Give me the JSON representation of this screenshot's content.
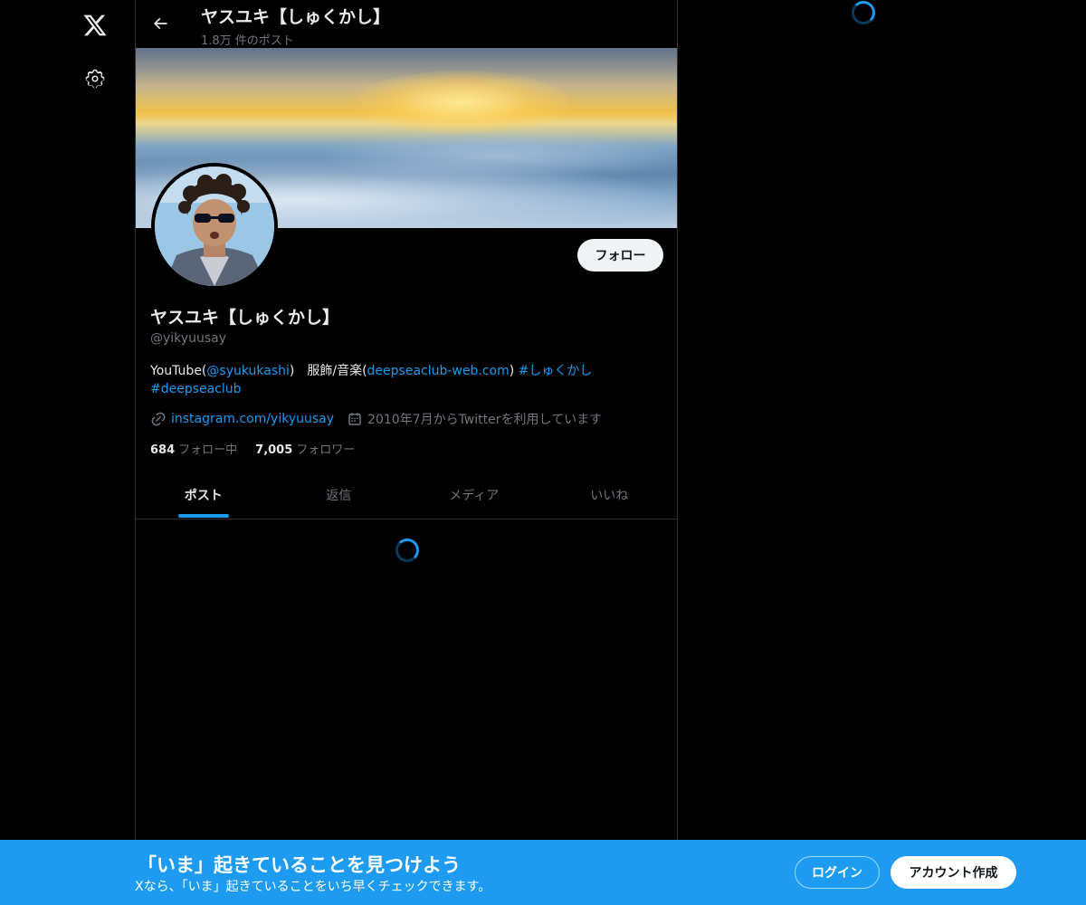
{
  "nav": {
    "logo_icon": "x-logo-icon",
    "settings_icon": "gear-icon"
  },
  "header": {
    "name": "ヤスユキ【しゅくかし】",
    "post_count": "1.8万 件のポスト"
  },
  "profile": {
    "name": "ヤスユキ【しゅくかし】",
    "handle": "@yikyuusay",
    "follow_label": "フォロー",
    "bio": {
      "part1": "YouTube(",
      "mention": "@syukukashi",
      "part2": ")　服飾/音楽(",
      "link": "deepseaclub-web.com",
      "part3": ") ",
      "hashtag1": "#しゅくかし",
      "hashtag2": "#deepseaclub"
    },
    "website": "instagram.com/yikyuusay",
    "joined": "2010年7月からTwitterを利用しています",
    "following_count": "684",
    "following_label": "フォロー中",
    "followers_count": "7,005",
    "followers_label": "フォロワー"
  },
  "tabs": [
    {
      "label": "ポスト",
      "active": true
    },
    {
      "label": "返信",
      "active": false
    },
    {
      "label": "メディア",
      "active": false
    },
    {
      "label": "いいね",
      "active": false
    }
  ],
  "bottom_bar": {
    "title": "「いま」起きていることを見つけよう",
    "subtitle": "Xなら、「いま」起きていることをいち早くチェックできます。",
    "login_label": "ログイン",
    "signup_label": "アカウント作成"
  },
  "colors": {
    "accent": "#1d9bf0",
    "background": "#000000",
    "text_primary": "#e7e9ea",
    "text_secondary": "#71767b"
  }
}
